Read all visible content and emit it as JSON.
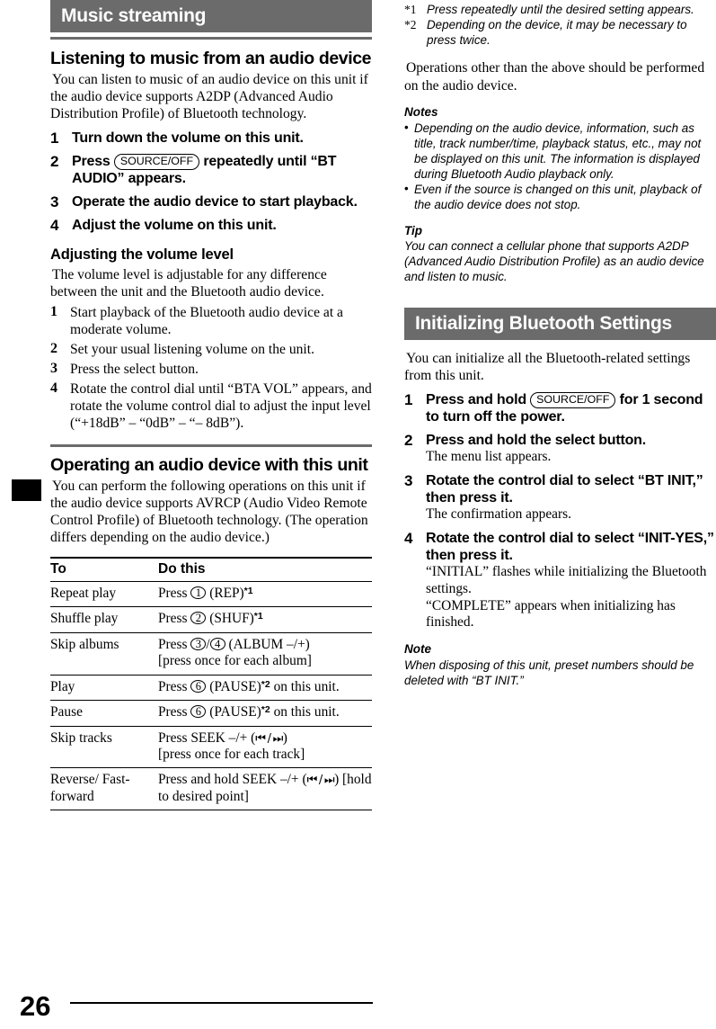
{
  "page": {
    "number": "26",
    "left_tab": "chapter-tab"
  },
  "left_column": {
    "section_title": "Music streaming",
    "heading1": "Listening to music from an audio device",
    "intro1": "You can listen to music of an audio device on this unit if the audio device supports A2DP (Advanced Audio Distribution Profile) of Bluetooth technology.",
    "steps1": [
      {
        "num": "1",
        "text_a": "Turn down the volume on this unit.",
        "pill": "",
        "text_b": ""
      },
      {
        "num": "2",
        "text_a": "Press ",
        "pill": "SOURCE/OFF",
        "text_b": " repeatedly until “BT AUDIO” appears."
      },
      {
        "num": "3",
        "text_a": "Operate the audio device to start playback.",
        "pill": "",
        "text_b": ""
      },
      {
        "num": "4",
        "text_a": "Adjust the volume on this unit.",
        "pill": "",
        "text_b": ""
      }
    ],
    "heading2": "Adjusting the volume level",
    "intro2": "The volume level is adjustable for any difference between the unit and the Bluetooth audio device.",
    "steps2": [
      {
        "num": "1",
        "text": "Start playback of the Bluetooth audio device at a moderate volume."
      },
      {
        "num": "2",
        "text": "Set your usual listening volume on the unit."
      },
      {
        "num": "3",
        "text": "Press the select button."
      },
      {
        "num": "4",
        "text": "Rotate the control dial until “BTA VOL” appears, and rotate the volume control dial to adjust the input level (“+18dB” – “0dB” – “– 8dB”)."
      }
    ],
    "heading3": "Operating an audio device with this unit",
    "intro3": "You can perform the following operations on this unit if the audio device supports AVRCP (Audio Video Remote Control Profile) of Bluetooth technology. (The operation differs depending on the audio device.)",
    "table": {
      "headers": [
        "To",
        "Do this"
      ],
      "rows": [
        {
          "to": "Repeat play",
          "do_pre": "Press ",
          "buttons": [
            "1"
          ],
          "do_post": " (REP)",
          "footnote": "*1",
          "do_extra": ""
        },
        {
          "to": "Shuffle play",
          "do_pre": "Press ",
          "buttons": [
            "2"
          ],
          "do_post": " (SHUF)",
          "footnote": "*1",
          "do_extra": ""
        },
        {
          "to": "Skip albums",
          "do_pre": "Press ",
          "buttons": [
            "3",
            "4"
          ],
          "do_post": " (ALBUM –/+)",
          "footnote": "",
          "do_extra": "[press once for each album]"
        },
        {
          "to": "Play",
          "do_pre": "Press ",
          "buttons": [
            "6"
          ],
          "do_post": " (PAUSE)",
          "footnote": "*2",
          "do_extra": " on this unit."
        },
        {
          "to": "Pause",
          "do_pre": "Press ",
          "buttons": [
            "6"
          ],
          "do_post": " (PAUSE)",
          "footnote": "*2",
          "do_extra": " on this unit."
        },
        {
          "to": "Skip tracks",
          "do_pre": "Press SEEK –/+ (",
          "buttons": [],
          "do_post": ")",
          "footnote": "",
          "do_extra": "[press once for each track]",
          "seek": true
        },
        {
          "to": "Reverse/ Fast-forward",
          "do_pre": "Press and hold SEEK –/+ (",
          "buttons": [],
          "do_post": ") [hold to desired point]",
          "footnote": "",
          "do_extra": "",
          "seek": true
        }
      ]
    }
  },
  "right_column": {
    "footnotes": [
      {
        "mark": "*1",
        "text": "Press repeatedly until the desired setting appears."
      },
      {
        "mark": "*2",
        "text": "Depending on the device, it may be necessary to press twice."
      }
    ],
    "para1": "Operations other than the above should be performed on the audio device.",
    "notes_heading": "Notes",
    "notes": [
      "Depending on the audio device, information, such as title, track number/time, playback status, etc., may not be displayed on this unit. The information is displayed during Bluetooth Audio playback only.",
      "Even if the source is changed on this unit, playback of the audio device does not stop."
    ],
    "tip_heading": "Tip",
    "tip_body": "You can connect a cellular phone that supports A2DP (Advanced Audio Distribution Profile) as an audio device and listen to music.",
    "section_title": "Initializing Bluetooth Settings",
    "intro": "You can initialize all the Bluetooth-related settings from this unit.",
    "steps": [
      {
        "num": "1",
        "bold_a": "Press and hold ",
        "pill": "SOURCE/OFF",
        "bold_b": " for 1 second to turn off the power.",
        "sub": ""
      },
      {
        "num": "2",
        "bold_a": "Press and hold the select button.",
        "pill": "",
        "bold_b": "",
        "sub": "The menu list appears."
      },
      {
        "num": "3",
        "bold_a": "Rotate the control dial to select “BT INIT,” then press it.",
        "pill": "",
        "bold_b": "",
        "sub": "The confirmation appears."
      },
      {
        "num": "4",
        "bold_a": "Rotate the control dial to select “INIT-YES,” then press it.",
        "pill": "",
        "bold_b": "",
        "sub": "“INITIAL” flashes while initializing the Bluetooth settings.\n“COMPLETE” appears when initializing has finished."
      }
    ],
    "note_heading": "Note",
    "note_body": "When disposing of this unit, preset numbers should be deleted with “BT INIT.”"
  },
  "colors": {
    "bar_gray": "#6b6b6b",
    "text": "#000000",
    "page_bg": "#ffffff"
  }
}
